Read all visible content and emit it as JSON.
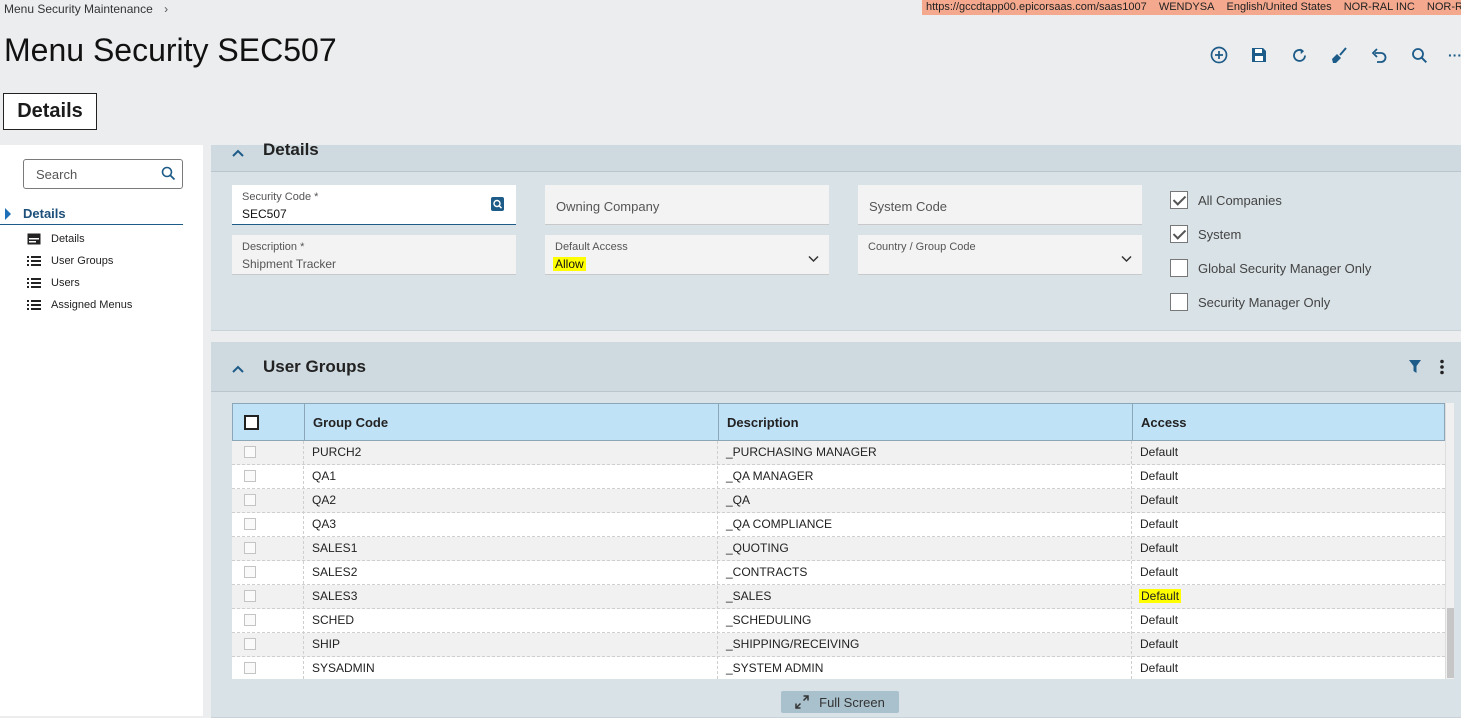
{
  "breadcrumb": {
    "label": "Menu Security Maintenance",
    "chevron": "›"
  },
  "session": {
    "url": "https://gccdtapp00.epicorsaas.com/saas1007",
    "user": "WENDYSA",
    "locale": "English/United States",
    "company": "NOR-RAL INC",
    "site": "NOR-RAL"
  },
  "page": {
    "title": "Menu Security SEC507",
    "active_tab": "Details"
  },
  "toolbar": {
    "icons": [
      "add-new-icon",
      "save-icon",
      "refresh-icon",
      "clear-icon",
      "undo-icon",
      "search-icon",
      "more-icon"
    ],
    "more_glyph": "···"
  },
  "sidebar": {
    "search_placeholder": "Search",
    "section": "Details",
    "items": [
      {
        "label": "Details",
        "icon": "card-icon"
      },
      {
        "label": "User Groups",
        "icon": "list-icon"
      },
      {
        "label": "Users",
        "icon": "list-icon"
      },
      {
        "label": "Assigned Menus",
        "icon": "list-icon"
      }
    ]
  },
  "details": {
    "title": "Details",
    "security_code": {
      "label": "Security Code *",
      "value": "SEC507"
    },
    "owning_company": {
      "placeholder": "Owning Company"
    },
    "system_code": {
      "placeholder": "System Code"
    },
    "description": {
      "label": "Description *",
      "value": "Shipment Tracker"
    },
    "default_access": {
      "label": "Default Access",
      "value": "Allow"
    },
    "country_group": {
      "label": "Country / Group Code",
      "value": ""
    },
    "checkboxes": [
      {
        "label": "All Companies",
        "checked": true
      },
      {
        "label": "System",
        "checked": true
      },
      {
        "label": "Global Security Manager Only",
        "checked": false
      },
      {
        "label": "Security Manager Only",
        "checked": false
      }
    ]
  },
  "user_groups": {
    "title": "User Groups",
    "columns": [
      "Group Code",
      "Description",
      "Access"
    ],
    "rows": [
      {
        "code": "PURCH2",
        "description": "_PURCHASING MANAGER",
        "access": "Default"
      },
      {
        "code": "QA1",
        "description": "_QA MANAGER",
        "access": "Default"
      },
      {
        "code": "QA2",
        "description": "_QA",
        "access": "Default"
      },
      {
        "code": "QA3",
        "description": "_QA COMPLIANCE",
        "access": "Default"
      },
      {
        "code": "SALES1",
        "description": "_QUOTING",
        "access": "Default"
      },
      {
        "code": "SALES2",
        "description": "_CONTRACTS",
        "access": "Default"
      },
      {
        "code": "SALES3",
        "description": "_SALES",
        "access": "Default"
      },
      {
        "code": "SCHED",
        "description": "_SCHEDULING",
        "access": "Default"
      },
      {
        "code": "SHIP",
        "description": "_SHIPPING/RECEIVING",
        "access": "Default"
      },
      {
        "code": "SYSADMIN",
        "description": "_SYSTEM ADMIN",
        "access": "Default"
      }
    ],
    "full_screen_label": "Full Screen"
  },
  "colors": {
    "accent": "#1d5b88",
    "highlight": "#ffff00",
    "session_bg": "#f4a98e",
    "grid_header": "#c0e2f7"
  }
}
